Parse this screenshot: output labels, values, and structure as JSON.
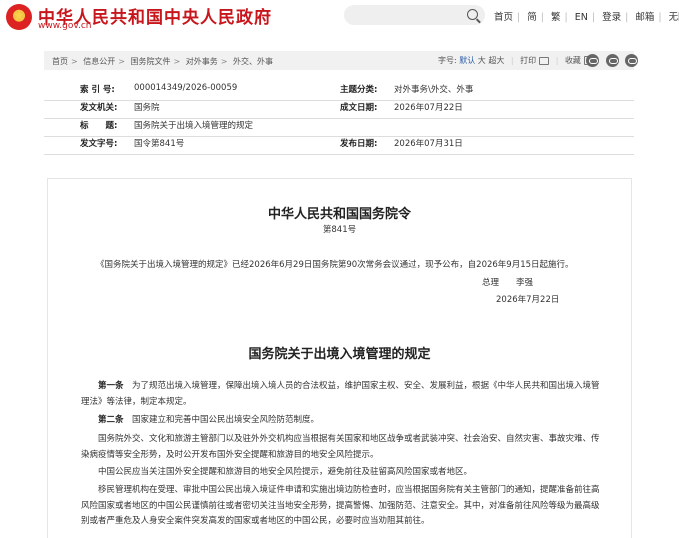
{
  "header": {
    "site_title": "中华人民共和国中央人民政府",
    "site_url": "www.gov.cn",
    "links": [
      "首页",
      "简",
      "繁",
      "EN",
      "登录",
      "邮箱",
      "无障碍"
    ]
  },
  "breadcrumb": [
    "首页",
    "信息公开",
    "国务院文件",
    "对外事务",
    "外交、外事"
  ],
  "tools": {
    "font_label": "字号:",
    "font_sizes": [
      "默认",
      "大",
      "超大"
    ],
    "print": "打印",
    "favorite": "收藏",
    "share_icons": [
      "wechat-icon",
      "weibo-icon",
      "qzone-icon"
    ]
  },
  "meta": {
    "index_no_label": "索 引 号:",
    "index_no": "000014349/2026-00059",
    "category_label": "主题分类:",
    "category": "对外事务\\外交、外事",
    "issuer_label": "发文机关:",
    "issuer": "国务院",
    "created_label": "成文日期:",
    "created": "2026年07月22日",
    "title_label": "标　　题:",
    "title": "国务院关于出境入境管理的规定",
    "doc_no_label": "发文字号:",
    "doc_no": "国令第841号",
    "published_label": "发布日期:",
    "published": "2026年07月31日"
  },
  "document": {
    "order_title": "中华人民共和国国务院令",
    "order_no": "第841号",
    "intro": "《国务院关于出境入境管理的规定》已经2026年6月29日国务院第90次常务会议通过，现予公布，自2026年9月15日起施行。",
    "premier": "总理　　李强",
    "sign_date": "2026年7月22日",
    "regulation_title": "国务院关于出境入境管理的规定",
    "articles": [
      {
        "head": "第一条",
        "text": "　为了规范出境入境管理，保障出境入境人员的合法权益，维护国家主权、安全、发展利益，根据《中华人民共和国出境入境管理法》等法律，制定本规定。"
      },
      {
        "head": "第二条",
        "text": "　国家建立和完善中国公民出境安全风险防范制度。"
      },
      {
        "head": "",
        "text": "国务院外交、文化和旅游主管部门以及驻外外交机构应当根据有关国家和地区战争或者武装冲突、社会治安、自然灾害、事故灾难、传染病疫情等安全形势，及时公开发布国外安全提醒和旅游目的地安全风险提示。"
      },
      {
        "head": "",
        "text": "中国公民应当关注国外安全提醒和旅游目的地安全风险提示，避免前往及驻留高风险国家或者地区。"
      },
      {
        "head": "",
        "text": "移民管理机构在受理、审批中国公民出境入境证件申请和实施出境边防检查时，应当根据国务院有关主管部门的通知，提醒准备前往高风险国家或者地区的中国公民谨慎前往或者密切关注当地安全形势，提高警惕、加强防范、注意安全。其中，对准备前往风险等级为最高级别或者严重危及人身安全案件突发高发的国家或者地区的中国公民，必要时应当劝阻其前往。"
      }
    ]
  }
}
